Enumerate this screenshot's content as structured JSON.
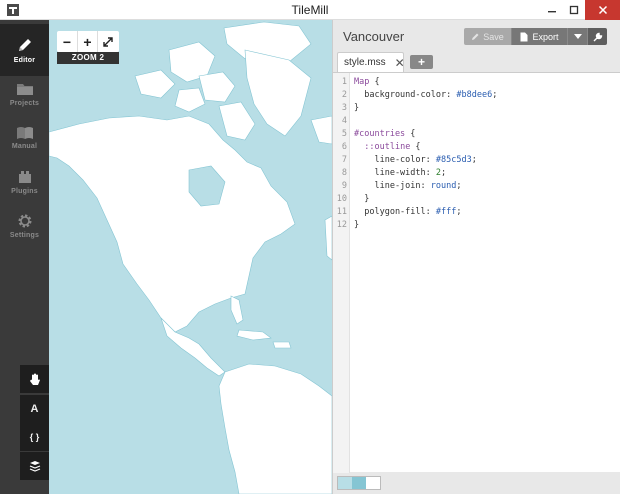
{
  "window": {
    "title": "TileMill",
    "controls": [
      "minimize-icon",
      "maximize-icon",
      "close-icon"
    ]
  },
  "sidebar": {
    "items": [
      {
        "label": "Editor",
        "icon": "pencil-icon",
        "active": true
      },
      {
        "label": "Projects",
        "icon": "folder-icon",
        "active": false
      },
      {
        "label": "Manual",
        "icon": "book-icon",
        "active": false
      },
      {
        "label": "Plugins",
        "icon": "plugin-icon",
        "active": false
      },
      {
        "label": "Settings",
        "icon": "gear-icon",
        "active": false
      }
    ],
    "tools": [
      {
        "name": "pan-tool",
        "icon": "hand-icon",
        "glyph": ""
      },
      {
        "name": "font-tool",
        "icon": "font-icon",
        "glyph": "A"
      },
      {
        "name": "carto-reference-tool",
        "icon": "braces-icon",
        "glyph": "{ }"
      },
      {
        "name": "layers-tool",
        "icon": "layers-icon",
        "glyph": ""
      }
    ]
  },
  "map": {
    "zoom_label": "ZOOM 2",
    "zoom_in": "+",
    "zoom_out": "−",
    "fullscreen_icon": "expand-icon",
    "water_color": "#b8dee6",
    "land_color": "#ffffff",
    "outline_color": "#85c5d3"
  },
  "editor": {
    "project_title": "Vancouver",
    "save_label": "Save",
    "export_label": "Export",
    "tab": {
      "label": "style.mss",
      "close": "✕"
    },
    "add_tab_label": "+",
    "lines": [
      {
        "n": "1",
        "text": "Map {"
      },
      {
        "n": "2",
        "text": "  background-color: #b8dee6;"
      },
      {
        "n": "3",
        "text": "}"
      },
      {
        "n": "4",
        "text": ""
      },
      {
        "n": "5",
        "text": "#countries {"
      },
      {
        "n": "6",
        "text": "  ::outline {"
      },
      {
        "n": "7",
        "text": "    line-color: #85c5d3;"
      },
      {
        "n": "8",
        "text": "    line-width: 2;"
      },
      {
        "n": "9",
        "text": "    line-join: round;"
      },
      {
        "n": "10",
        "text": "  }"
      },
      {
        "n": "11",
        "text": "  polygon-fill: #fff;"
      },
      {
        "n": "12",
        "text": "}"
      }
    ],
    "swatches": [
      "#b8dee6",
      "#85c5d3",
      "#ffffff"
    ]
  }
}
